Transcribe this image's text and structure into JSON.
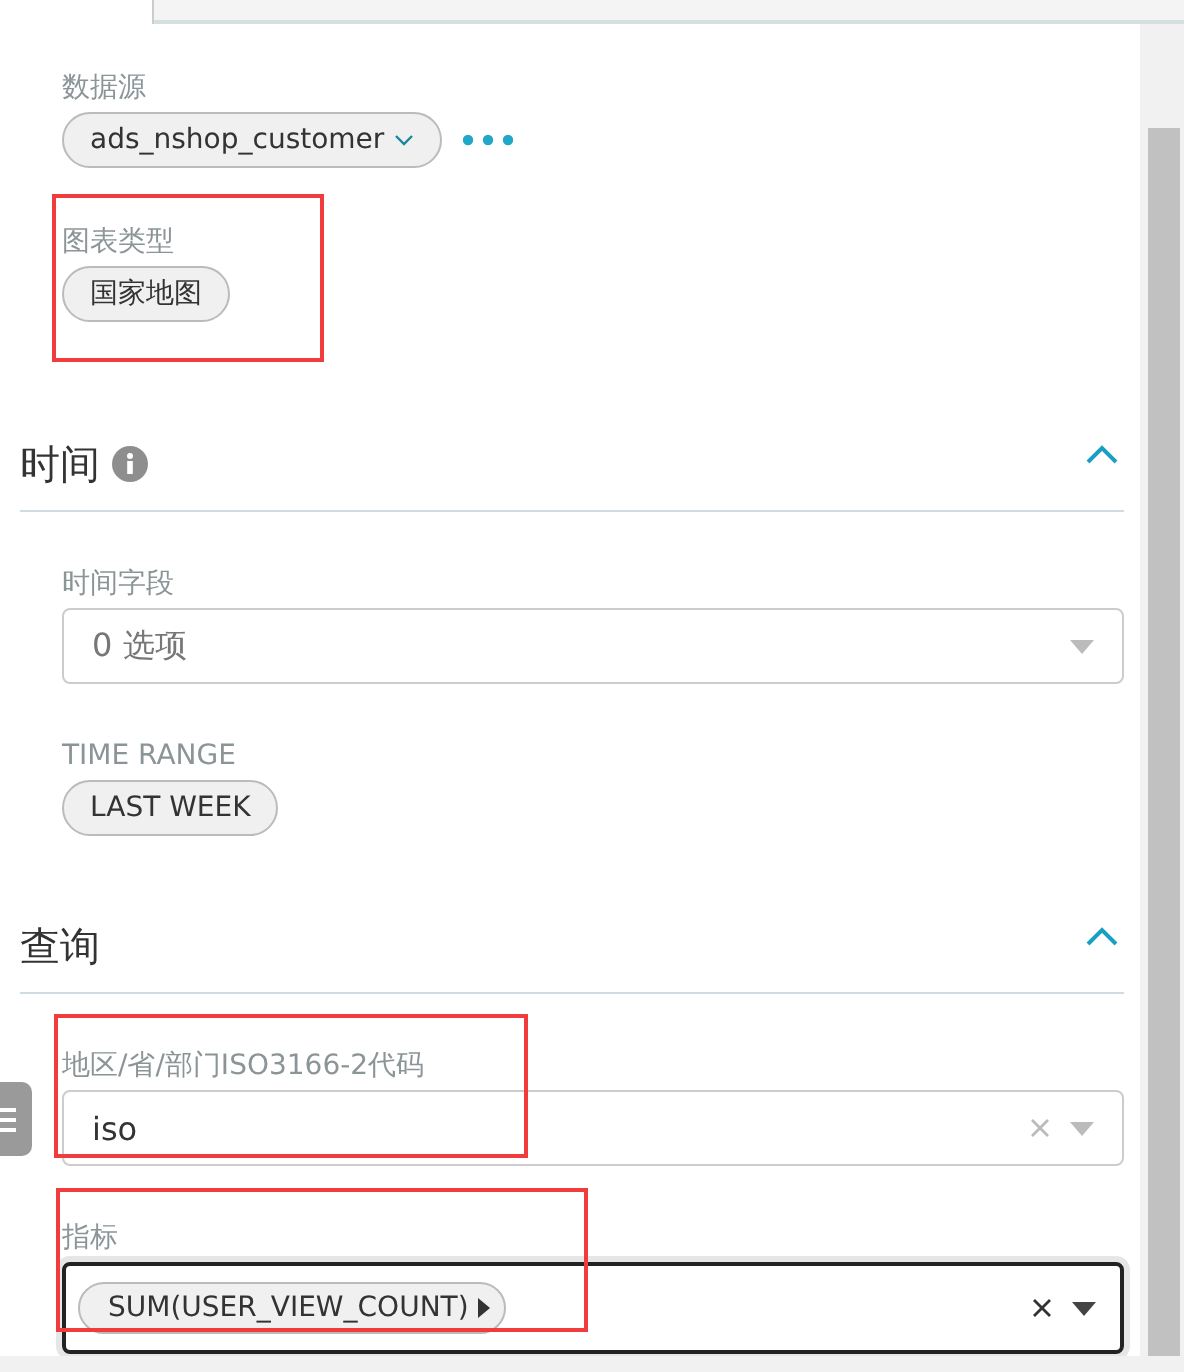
{
  "datasource": {
    "label": "数据源",
    "value": "ads_nshop_customer"
  },
  "chart_type": {
    "label": "图表类型",
    "value": "国家地图",
    "highlighted": true
  },
  "sections": [
    {
      "title": "时间",
      "info": true,
      "expanded": true,
      "fields": [
        {
          "kind": "select",
          "label": "时间字段",
          "placeholder": "0 选项",
          "focused": false
        },
        {
          "kind": "chip",
          "label": "TIME RANGE",
          "value": "LAST WEEK"
        }
      ]
    },
    {
      "title": "查询",
      "expanded": true,
      "fields": [
        {
          "kind": "select",
          "label": "地区/省/部门ISO3166-2代码",
          "value": "iso",
          "highlighted": true,
          "clearable": true,
          "focused": false
        },
        {
          "kind": "multi",
          "label": "指标",
          "value": "SUM(USER_VIEW_COUNT)",
          "highlighted": true,
          "clearable": true,
          "focused": true
        }
      ]
    }
  ]
}
